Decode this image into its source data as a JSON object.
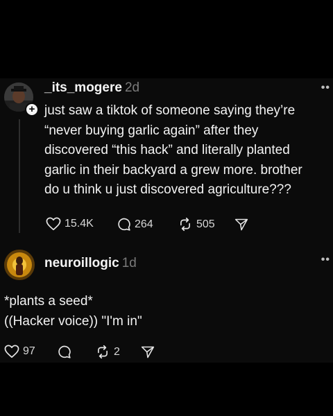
{
  "post": {
    "username": "_its_mogere",
    "time": "2d",
    "more_label": "••",
    "text_lines": [
      "just saw a tiktok of someone saying they’re",
      "“never buying garlic again” after they",
      "discovered “this hack” and literally planted",
      "garlic in their backyard a grew more. brother",
      "do u think u just discovered agriculture???"
    ],
    "likes": "15.4K",
    "comments": "264",
    "reposts": "505",
    "follow_badge": "+",
    "icons": [
      "heart-icon",
      "comment-icon",
      "repost-icon",
      "share-icon",
      "more-icon",
      "plus-icon"
    ]
  },
  "reply": {
    "username": "neuroillogic",
    "time": "1d",
    "more_label": "••",
    "text_lines": [
      "*plants a seed*",
      "((Hacker voice)) \"I'm in\""
    ],
    "likes": "97",
    "comments": "",
    "reposts": "2",
    "icons": [
      "heart-icon",
      "comment-icon",
      "repost-icon",
      "share-icon",
      "more-icon"
    ]
  },
  "colors": {
    "background": "#000000",
    "panel": "#0b0b0b",
    "text": "#f3f3f3",
    "muted": "#7a7a7a"
  }
}
